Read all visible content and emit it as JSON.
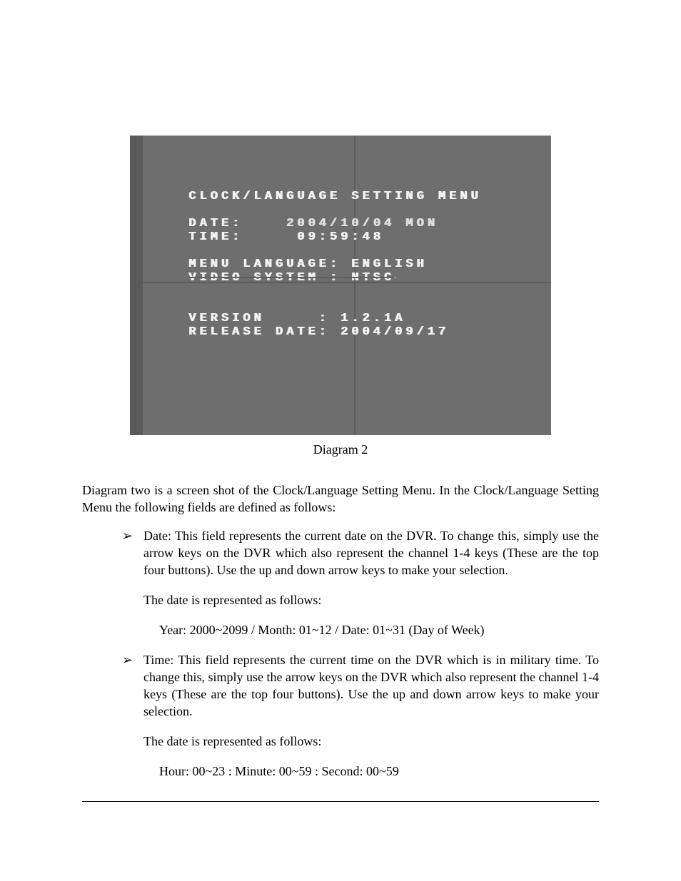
{
  "screenshot": {
    "title": "CLOCK/LANGUAGE SETTING MENU",
    "rows": {
      "date_label": "DATE:",
      "date_value": "2004/10/04 MON",
      "time_label": "TIME:",
      "time_value": "09:59:48",
      "menulang_label": "MENU LANGUAGE:",
      "menulang_value": "ENGLISH",
      "videosys_label": "VIDEO SYSTEM :",
      "videosys_value": "NTSC",
      "version_label": "VERSION     :",
      "version_value": "1.2.1A",
      "reldate_label": "RELEASE DATE:",
      "reldate_value": "2004/09/17"
    }
  },
  "caption": "Diagram 2",
  "intro": " Diagram two is a screen shot of the Clock/Language Setting Menu. In the Clock/Language Setting Menu the following fields are defined as follows:",
  "bullets": {
    "date": {
      "main": "Date: This field represents the current date on the DVR. To change this, simply use the arrow keys on the DVR which also represent the channel 1-4 keys (These are the top four buttons). Use the up and down arrow keys to make your selection.",
      "sub1": "The date is represented as follows:",
      "sub2": "Year: 2000~2099 / Month: 01~12 / Date: 01~31    (Day of Week)"
    },
    "time": {
      "main": "Time: This field represents the current time on the DVR which is in military time. To change this, simply use the arrow keys on the DVR which also represent the channel 1-4 keys (These are the top four buttons). Use the up and down arrow keys to make your selection.",
      "sub1": "The date is represented as follows:",
      "sub2": "Hour: 00~23 : Minute: 00~59 : Second: 00~59"
    }
  }
}
